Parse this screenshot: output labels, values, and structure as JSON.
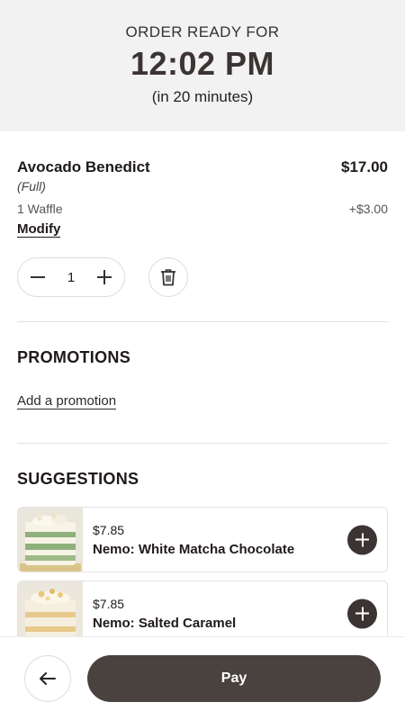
{
  "header": {
    "label": "ORDER READY FOR",
    "time": "12:02 PM",
    "eta": "(in 20 minutes)"
  },
  "cart_item": {
    "name": "Avocado Benedict",
    "price": "$17.00",
    "variant": "(Full)",
    "option_name": "1 Waffle",
    "option_price": "+$3.00",
    "modify_label": "Modify",
    "quantity": "1",
    "icons": [
      "minus-icon",
      "plus-icon",
      "trash-icon"
    ]
  },
  "promotions": {
    "title": "PROMOTIONS",
    "add_label": "Add a promotion"
  },
  "suggestions": {
    "title": "SUGGESTIONS",
    "items": [
      {
        "price": "$7.85",
        "name": "Nemo: White Matcha Chocolate",
        "image": "matcha-cake-image"
      },
      {
        "price": "$7.85",
        "name": "Nemo: Salted Caramel",
        "image": "caramel-cake-image"
      }
    ]
  },
  "footer": {
    "back_icon": "arrow-left-icon",
    "pay_label": "Pay"
  },
  "colors": {
    "header_bg": "#f2f2f2",
    "accent_dark": "#3b3433",
    "pay_button": "#4a423f"
  }
}
